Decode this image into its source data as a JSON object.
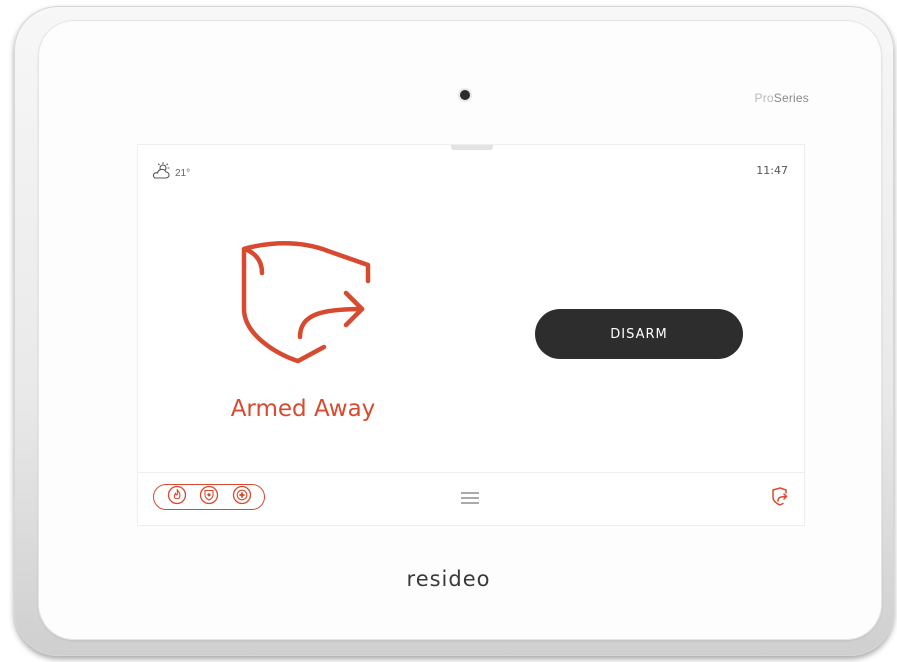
{
  "device": {
    "model_prefix": "Pro",
    "model_suffix": "Series",
    "brand": "resideo"
  },
  "screen": {
    "weather": {
      "icon": "cloudy-sun-icon",
      "temperature": "21°"
    },
    "clock": "11:47",
    "status": {
      "icon": "armed-away-shield-icon",
      "label": "Armed Away",
      "color": "#d84a2f"
    },
    "action_button": {
      "label": "DISARM",
      "color": "#2d2d2d"
    },
    "bottom_bar": {
      "emergency_icons": [
        "fire-icon",
        "police-icon",
        "medical-icon"
      ],
      "menu_icon": "menu-icon",
      "status_icon": "armed-away-icon"
    }
  }
}
